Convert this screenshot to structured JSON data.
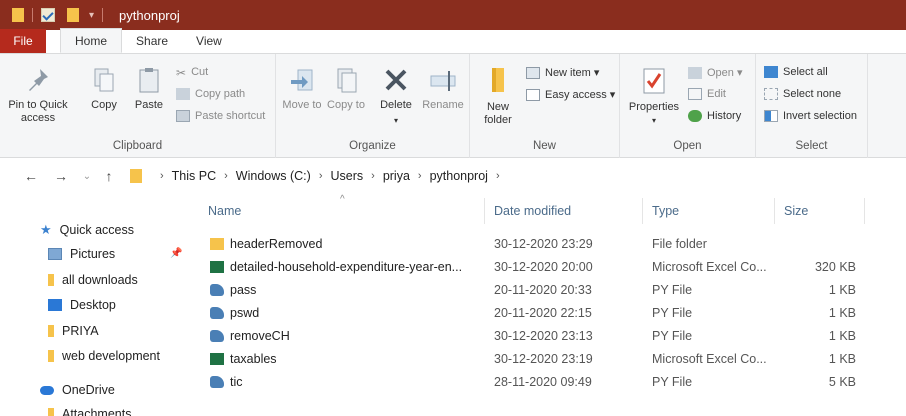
{
  "window": {
    "title": "pythonproj"
  },
  "tabs": [
    "File",
    "Home",
    "Share",
    "View"
  ],
  "ribbon": {
    "clipboard": {
      "pin_to_quick_access": "Pin to Quick access",
      "copy": "Copy",
      "paste": "Paste",
      "cut": "Cut",
      "copy_path": "Copy path",
      "paste_shortcut": "Paste shortcut",
      "label": "Clipboard"
    },
    "organize": {
      "move_to": "Move to",
      "copy_to": "Copy to",
      "delete": "Delete",
      "rename": "Rename",
      "label": "Organize"
    },
    "new": {
      "new_folder": "New folder",
      "new_item": "New item ▾",
      "easy_access": "Easy access ▾",
      "label": "New"
    },
    "open": {
      "properties": "Properties",
      "open": "Open ▾",
      "edit": "Edit",
      "history": "History",
      "label": "Open"
    },
    "select": {
      "select_all": "Select all",
      "select_none": "Select none",
      "invert_selection": "Invert selection",
      "label": "Select"
    }
  },
  "address": {
    "back": "←",
    "forward": "→",
    "recent": "⌄",
    "up": "↑",
    "crumbs": [
      "This PC",
      "Windows (C:)",
      "Users",
      "priya",
      "pythonproj"
    ]
  },
  "nav": {
    "quick_access": "Quick access",
    "items": [
      "Pictures",
      "all downloads",
      "Desktop",
      "PRIYA",
      "web development"
    ],
    "onedrive": "OneDrive",
    "attachments": "Attachments"
  },
  "columns": {
    "name": "Name",
    "date": "Date modified",
    "type": "Type",
    "size": "Size"
  },
  "files": [
    {
      "name": "headerRemoved",
      "date": "30-12-2020 23:29",
      "type": "File folder",
      "size": "",
      "icon": "folder-icon"
    },
    {
      "name": "detailed-household-expenditure-year-en...",
      "date": "30-12-2020 20:00",
      "type": "Microsoft Excel Co...",
      "size": "320 KB",
      "icon": "excel-icon"
    },
    {
      "name": "pass",
      "date": "20-11-2020 20:33",
      "type": "PY File",
      "size": "1 KB",
      "icon": "py-file-icon"
    },
    {
      "name": "pswd",
      "date": "20-11-2020 22:15",
      "type": "PY File",
      "size": "1 KB",
      "icon": "py-file-icon"
    },
    {
      "name": "removeCH",
      "date": "30-12-2020 23:13",
      "type": "PY File",
      "size": "1 KB",
      "icon": "py-file-icon"
    },
    {
      "name": "taxables",
      "date": "30-12-2020 23:19",
      "type": "Microsoft Excel Co...",
      "size": "1 KB",
      "icon": "excel-icon"
    },
    {
      "name": "tic",
      "date": "28-11-2020 09:49",
      "type": "PY File",
      "size": "5 KB",
      "icon": "py-file-icon"
    }
  ],
  "colors": {
    "titlebar": "#8a2d1e",
    "file_tab": "#b52a1d",
    "folder": "#f6c34b",
    "excel": "#1f7244",
    "py": "#4a7fb5"
  }
}
